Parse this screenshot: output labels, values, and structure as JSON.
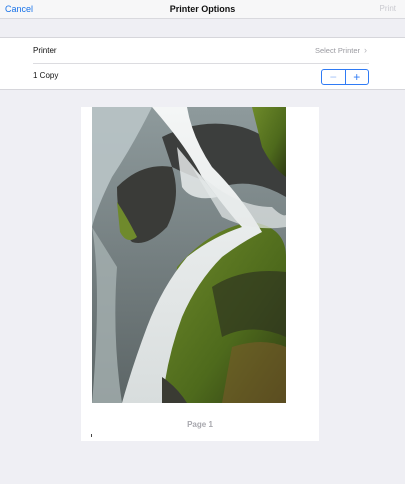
{
  "navbar": {
    "cancel_label": "Cancel",
    "title": "Printer Options",
    "print_label": "Print"
  },
  "options": {
    "printer_label": "Printer",
    "printer_value": "Select Printer",
    "copies_label": "1 Copy",
    "minus_symbol": "−",
    "plus_symbol": "+"
  },
  "preview": {
    "page_label": "Page 1"
  },
  "colors": {
    "accent": "#2f7bf5",
    "link": "#1a73e8",
    "background": "#efeff4"
  }
}
